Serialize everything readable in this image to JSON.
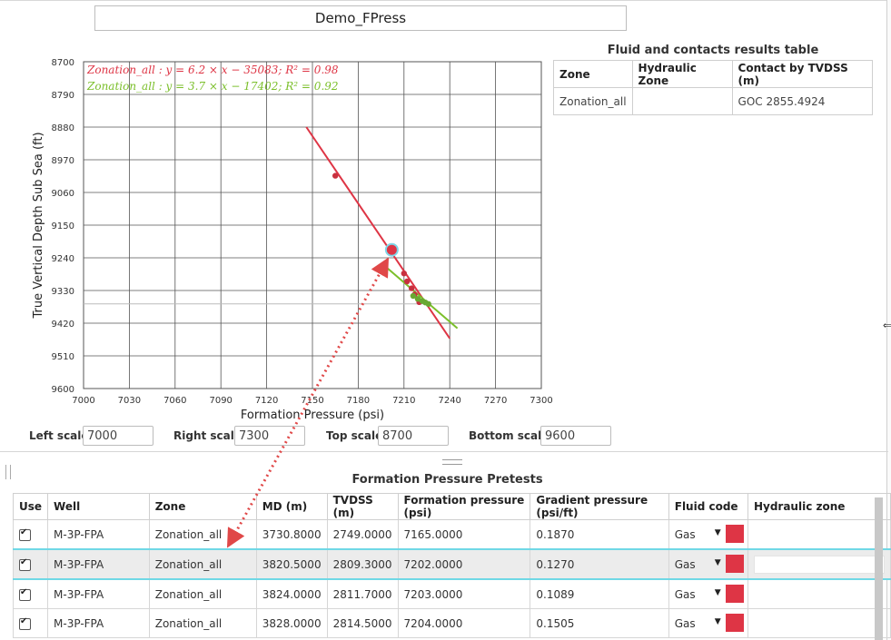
{
  "window": {
    "title": "Demo_FPress"
  },
  "chart_data": {
    "type": "scatter",
    "xlabel": "Formation Pressure (psi)",
    "ylabel": "True Vertical Depth Sub Sea (ft)",
    "xlim": [
      7000,
      7300
    ],
    "ylim": [
      8700,
      9600
    ],
    "y_inverted": true,
    "grid": true,
    "x_ticks": [
      "7000",
      "7030",
      "7060",
      "7090",
      "7120",
      "7150",
      "7180",
      "7210",
      "7240",
      "7270",
      "7300"
    ],
    "y_ticks": [
      "8700",
      "8790",
      "8880",
      "8970",
      "9060",
      "9150",
      "9240",
      "9330",
      "9420",
      "9510",
      "9600"
    ],
    "fit_labels": [
      {
        "text": "Zonation_all : y = 6.2 × x − 35083; R² = 0.98",
        "color": "#de3545"
      },
      {
        "text": "Zonation_all : y = 3.7 × x − 17402; R² = 0.92",
        "color": "#7bbf2a"
      }
    ],
    "fit_lines": [
      {
        "color": "#de3545",
        "points": [
          [
            7146,
            8880
          ],
          [
            7240,
            9462
          ]
        ]
      },
      {
        "color": "#7bbf2a",
        "points": [
          [
            7197,
            9261
          ],
          [
            7245,
            9434
          ]
        ]
      }
    ],
    "points_red": [
      [
        7165,
        9014
      ],
      [
        7210,
        9283
      ],
      [
        7212,
        9305
      ],
      [
        7215,
        9324
      ],
      [
        7217,
        9341
      ],
      [
        7220,
        9362
      ]
    ],
    "points_green": [
      [
        7216,
        9345
      ],
      [
        7219,
        9353
      ],
      [
        7222,
        9359
      ],
      [
        7226,
        9367
      ],
      [
        7224,
        9363
      ]
    ],
    "highlight_point": [
      7202,
      9218
    ],
    "horizontal_marker": 9367
  },
  "fluid_table": {
    "title": "Fluid and contacts results table",
    "headers": [
      "Zone",
      "Hydraulic Zone",
      "Contact by TVDSS (m)"
    ],
    "rows": [
      [
        "Zonation_all",
        "",
        "GOC 2855.4924"
      ]
    ]
  },
  "scales": {
    "left_label": "Left scale",
    "left_value": "7000",
    "right_label": "Right scale",
    "right_value": "7300",
    "top_label": "Top scale",
    "top_value": "8700",
    "bottom_label": "Bottom scale",
    "bottom_value": "9600"
  },
  "pretests": {
    "title": "Formation Pressure Pretests",
    "headers": [
      "Use",
      "Well",
      "Zone",
      "MD (m)",
      "TVDSS (m)",
      "Formation pressure (psi)",
      "Gradient pressure (psi/ft)",
      "Fluid code",
      "Hydraulic zone"
    ],
    "rows": [
      {
        "well": "M-3P-FPA",
        "zone": "Zonation_all",
        "md": "3730.8000",
        "tvdss": "2749.0000",
        "fp": "7165.0000",
        "grad": "0.1870",
        "fluid": "Gas"
      },
      {
        "well": "M-3P-FPA",
        "zone": "Zonation_all",
        "md": "3820.5000",
        "tvdss": "2809.3000",
        "fp": "7202.0000",
        "grad": "0.1270",
        "fluid": "Gas"
      },
      {
        "well": "M-3P-FPA",
        "zone": "Zonation_all",
        "md": "3824.0000",
        "tvdss": "2811.7000",
        "fp": "7203.0000",
        "grad": "0.1089",
        "fluid": "Gas"
      },
      {
        "well": "M-3P-FPA",
        "zone": "Zonation_all",
        "md": "3828.0000",
        "tvdss": "2814.5000",
        "fp": "7204.0000",
        "grad": "0.1505",
        "fluid": "Gas"
      }
    ]
  },
  "colors": {
    "swatch": "#de3545",
    "selection": "#6fd8e6",
    "arrow": "#e04848"
  }
}
